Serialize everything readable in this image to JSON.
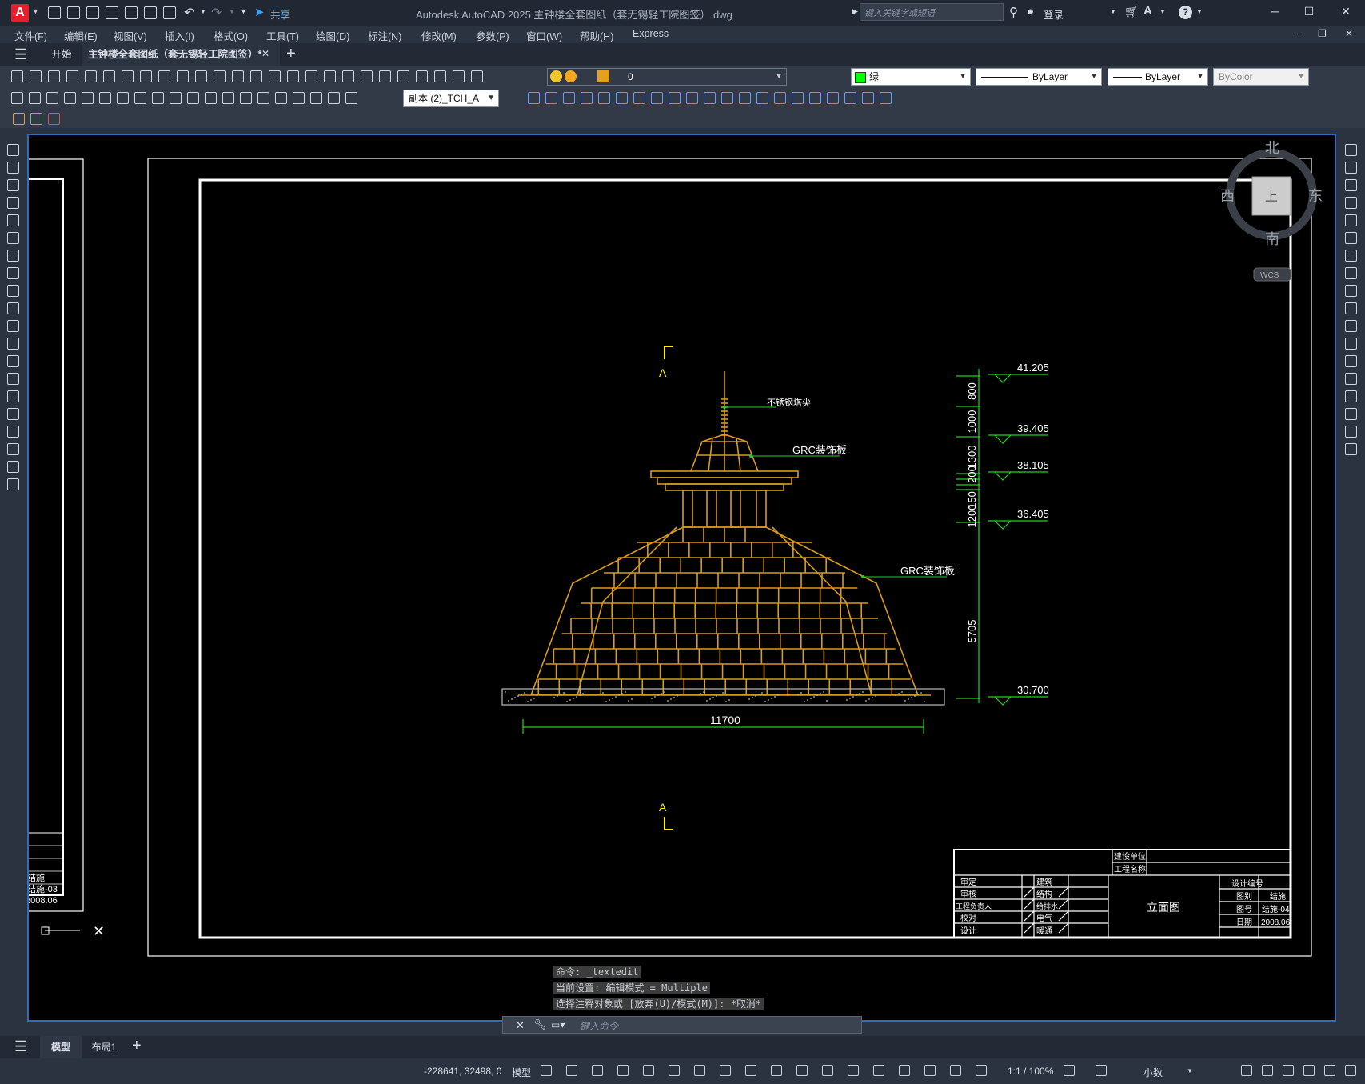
{
  "app": {
    "title": "Autodesk AutoCAD 2025    主钟楼全套图纸（套无锡轻工院图签）.dwg",
    "share_label": "共享",
    "search_placeholder": "键入关键字或短语",
    "login_label": "登录",
    "help_label": "?"
  },
  "menu": [
    "文件(F)",
    "编辑(E)",
    "视图(V)",
    "插入(I)",
    "格式(O)",
    "工具(T)",
    "绘图(D)",
    "标注(N)",
    "修改(M)",
    "参数(P)",
    "窗口(W)",
    "帮助(H)",
    "Express"
  ],
  "tabs": {
    "start": "开始",
    "file": "主钟楼全套图纸（套无锡轻工院图签）*",
    "add": "+"
  },
  "properties": {
    "layer_value": "0",
    "color_value": "绿",
    "linetype_value": "ByLayer",
    "lineweight_value": "ByLayer",
    "plotstyle_value": "ByColor",
    "dimstyle_value": "副本 (2)_TCH_A"
  },
  "colors": {
    "canvas_bg": "#000000",
    "drawing_orange": "#d89a1a",
    "dimension_green": "#1fd41f",
    "section_yellow": "#ffee00",
    "frame_white": "#ffffff",
    "layer_swatch_green": "#00ff00",
    "viewport_border": "#2d6fbd"
  },
  "viewcube": {
    "north": "北",
    "south": "南",
    "east": "东",
    "west": "西",
    "top_face": "上",
    "wcs": "WCS"
  },
  "drawing": {
    "section_mark": "A",
    "label_spire": "不锈钢塔尖",
    "label_grc_top": "GRC装饰板",
    "label_grc_side": "GRC装饰板",
    "width_dim": "11700",
    "elevations": [
      "41.205",
      "39.405",
      "38.105",
      "36.405",
      "30.700"
    ],
    "vertical_dims": [
      "800",
      "1000",
      "1300",
      "150",
      "150",
      "200",
      "1200",
      "5705"
    ]
  },
  "title_block": {
    "construction_unit": "建设单位",
    "project_name": "工程名称",
    "left_rows": [
      "审定",
      "审核",
      "工程负责人",
      "校对",
      "设计"
    ],
    "mid_rows": [
      "建筑",
      "结构",
      "给排水",
      "电气",
      "暖通"
    ],
    "drawing_name": "立面图",
    "right_labels": [
      "设计编号",
      "图别",
      "图号",
      "日期"
    ],
    "right_values": [
      "",
      "结施",
      "结施-04",
      "2008.06"
    ]
  },
  "left_sheet": {
    "rows": [
      "结施",
      "结施-03",
      "2008.06"
    ]
  },
  "command": {
    "history": [
      "命令:  _textedit",
      "当前设置: 编辑模式 = Multiple",
      "选择注释对象或 [放弃(U)/模式(M)]: *取消*"
    ],
    "placeholder": "键入命令"
  },
  "layouts": {
    "model": "模型",
    "layout1": "布局1",
    "add": "+"
  },
  "status": {
    "coords": "-228641, 32498, 0",
    "space": "模型",
    "scale": "1:1 / 100%",
    "units": "小数"
  }
}
